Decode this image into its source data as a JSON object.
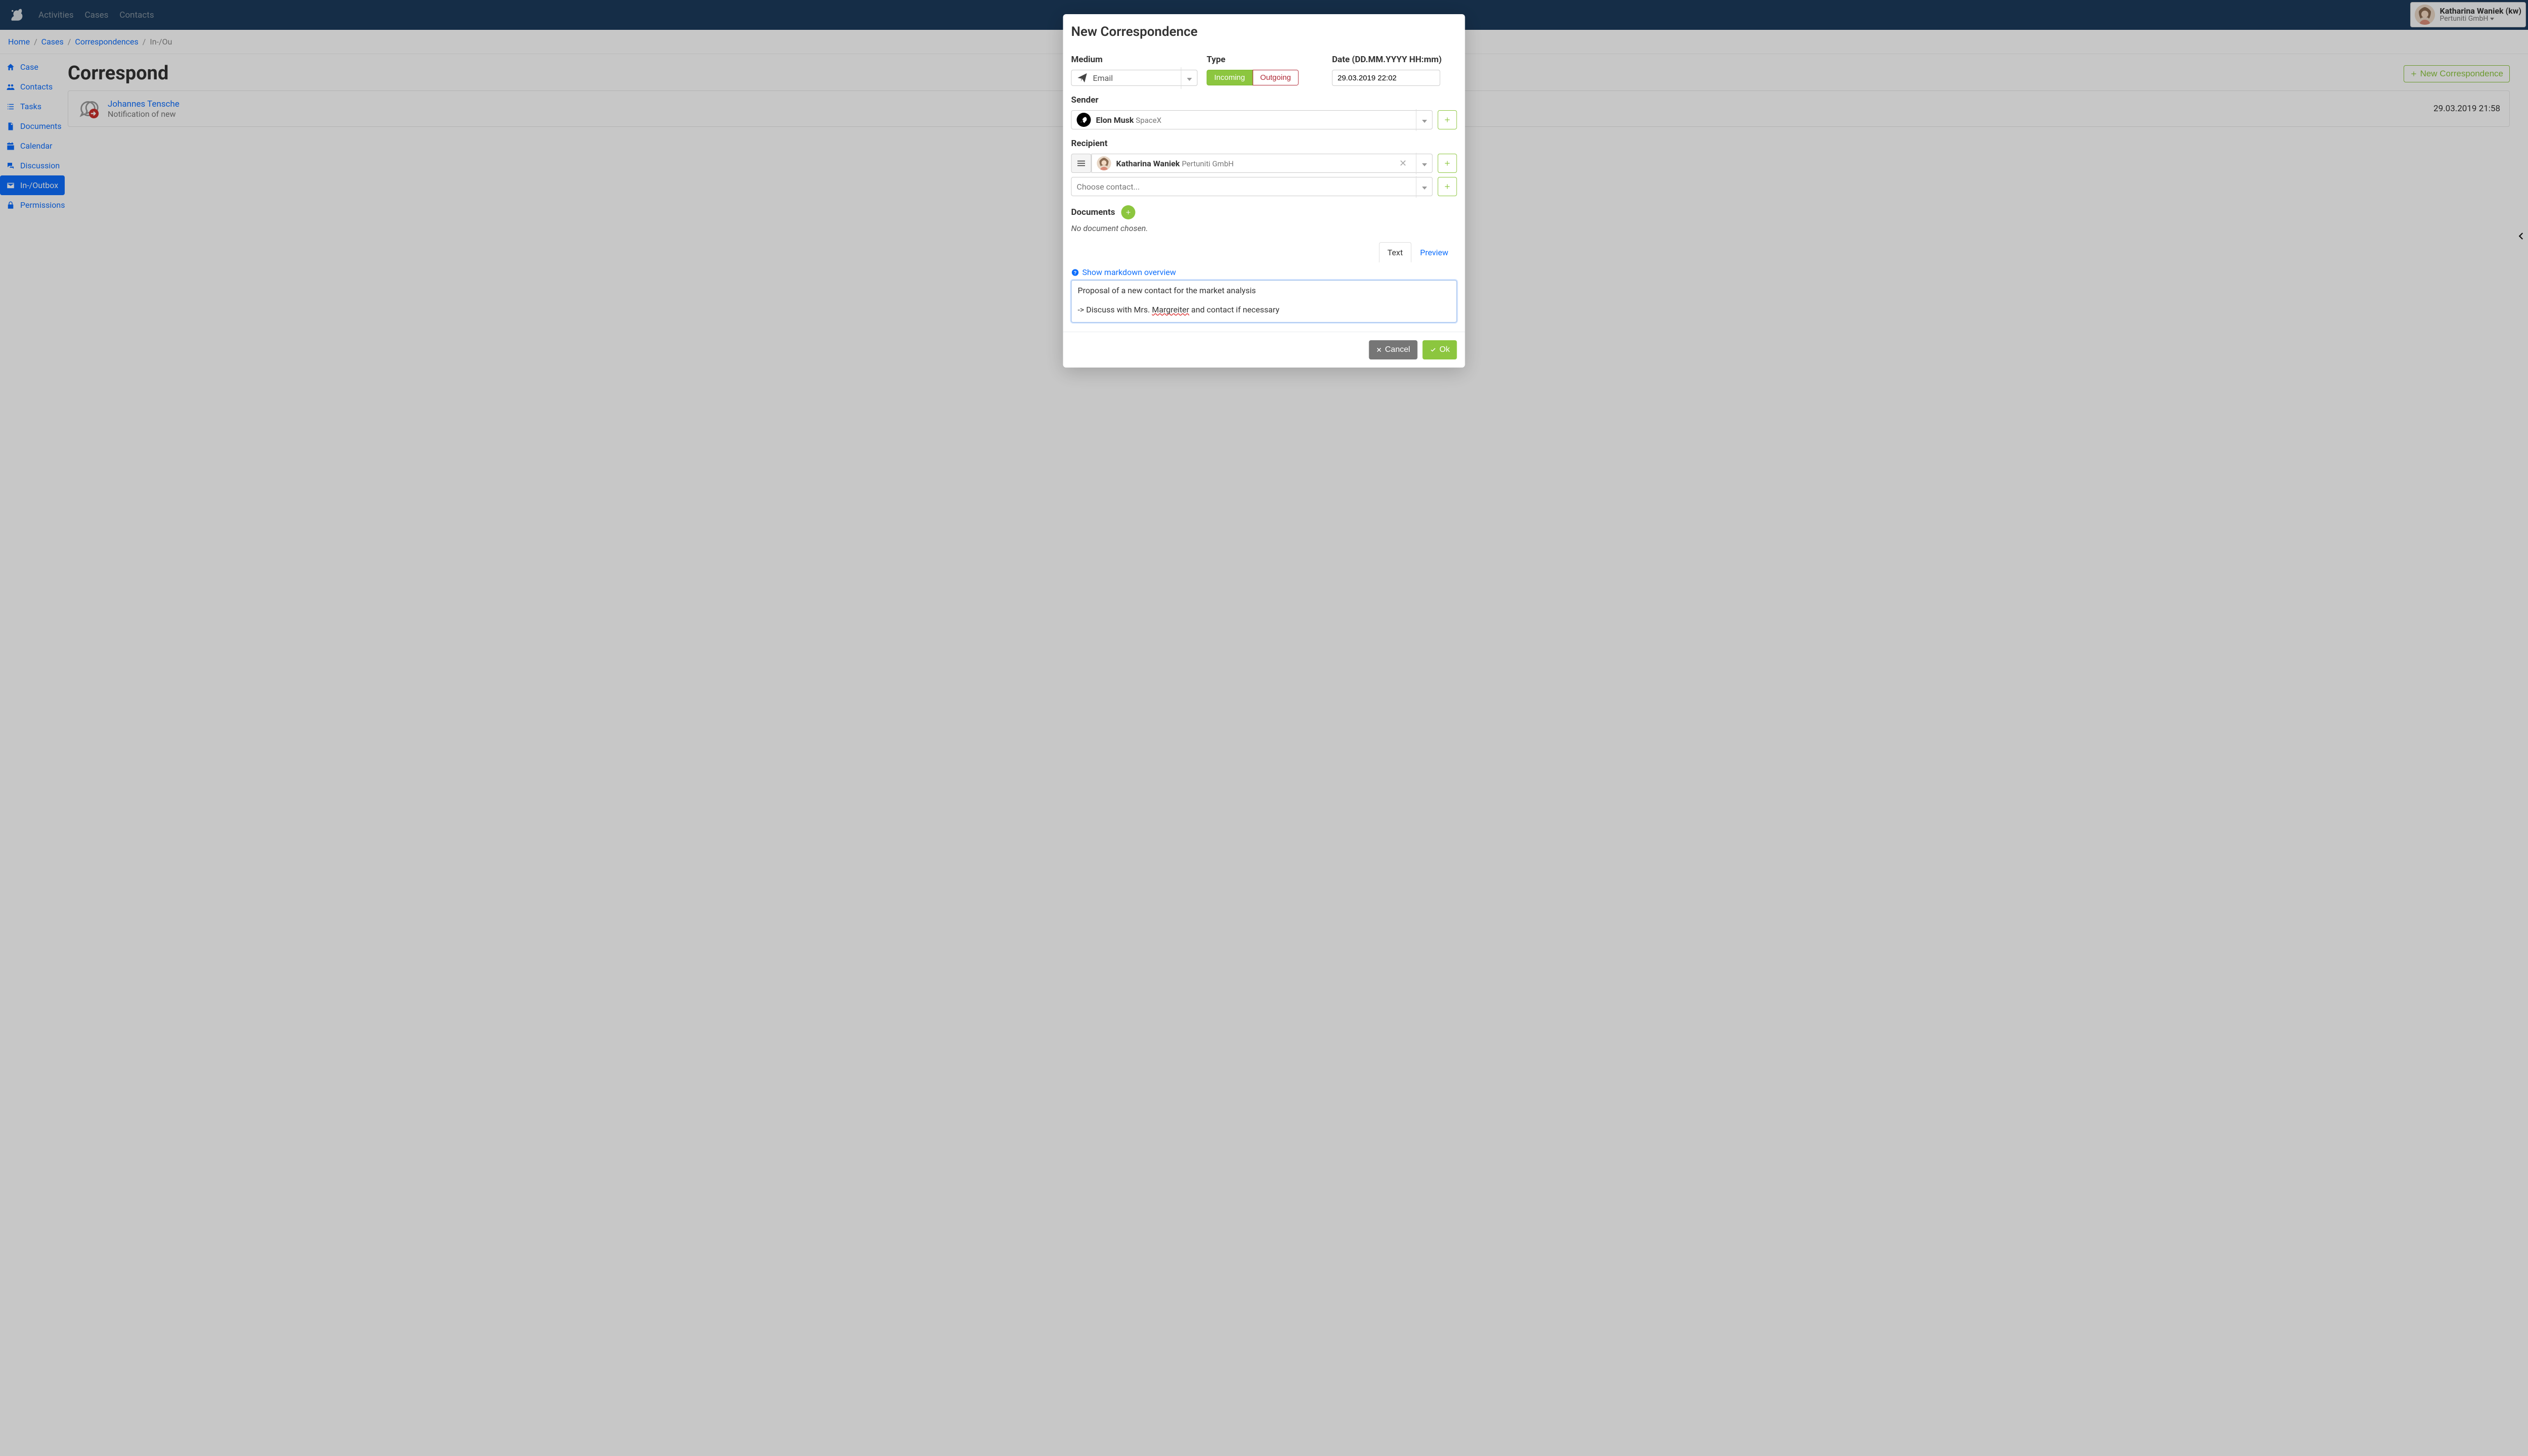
{
  "navbar": {
    "links": [
      "Activities",
      "Cases",
      "Contacts"
    ]
  },
  "user": {
    "name": "Katharina Waniek (kw)",
    "org": "Pertuniti GmbH"
  },
  "breadcrumb": {
    "items": [
      "Home",
      "Cases",
      "Correspondences"
    ],
    "current": "In-/Ou"
  },
  "sidenav": {
    "items": [
      {
        "icon": "home",
        "label": "Case"
      },
      {
        "icon": "users",
        "label": "Contacts"
      },
      {
        "icon": "list",
        "label": "Tasks"
      },
      {
        "icon": "file",
        "label": "Documents"
      },
      {
        "icon": "calendar",
        "label": "Calendar"
      },
      {
        "icon": "comments",
        "label": "Discussion"
      },
      {
        "icon": "envelope",
        "label": "In-/Outbox"
      },
      {
        "icon": "lock",
        "label": "Permissions"
      }
    ],
    "active_index": 6
  },
  "content": {
    "title": "Correspond",
    "new_btn": "New Correspondence",
    "row": {
      "author": "Johannes Tensche",
      "subject": "Notification of new",
      "date": "29.03.2019 21:58"
    }
  },
  "modal": {
    "title": "New Correspondence",
    "labels": {
      "medium": "Medium",
      "type": "Type",
      "date": "Date (DD.MM.YYYY HH:mm)",
      "sender": "Sender",
      "recipient": "Recipient",
      "documents": "Documents"
    },
    "medium_value": "Email",
    "type_incoming": "Incoming",
    "type_outgoing": "Outgoing",
    "date_value": "29.03.2019 22:02",
    "sender": {
      "name": "Elon Musk",
      "org": "SpaceX"
    },
    "recipient": {
      "name": "Katharina Waniek",
      "org": "Pertuniti GmbH"
    },
    "choose_placeholder": "Choose contact...",
    "no_document": "No document chosen.",
    "tabs": {
      "text": "Text",
      "preview": "Preview",
      "active": 0
    },
    "markdown_help": "Show markdown overview",
    "body_line1": "Proposal of a new contact for the market analysis",
    "body_line2a": "-> Discuss with Mrs. ",
    "body_misspell": "Margreiter",
    "body_line2b": " and contact if necessary",
    "cancel": "Cancel",
    "ok": "Ok"
  }
}
